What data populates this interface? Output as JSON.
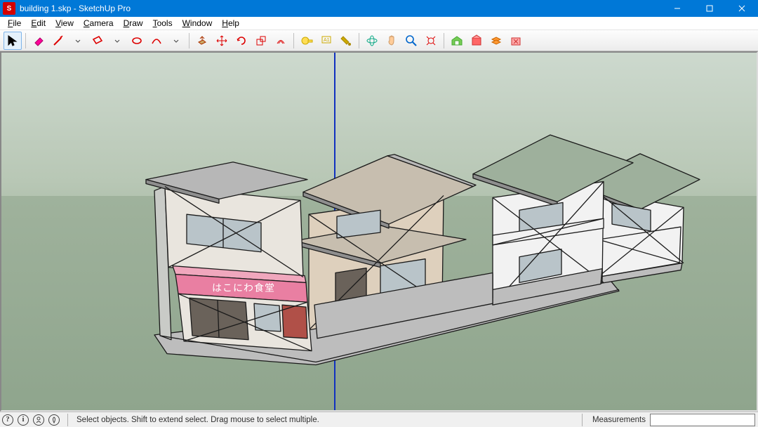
{
  "titlebar": {
    "title": "building 1.skp - SketchUp Pro"
  },
  "menus": {
    "file": {
      "label": "File",
      "hotkey_index": 0
    },
    "edit": {
      "label": "Edit",
      "hotkey_index": 0
    },
    "view": {
      "label": "View",
      "hotkey_index": 0
    },
    "camera": {
      "label": "Camera",
      "hotkey_index": 0
    },
    "draw": {
      "label": "Draw",
      "hotkey_index": 0
    },
    "tools": {
      "label": "Tools",
      "hotkey_index": 0
    },
    "window": {
      "label": "Window",
      "hotkey_index": 0
    },
    "help": {
      "label": "Help",
      "hotkey_index": 0
    }
  },
  "toolbar_icons": [
    "select",
    "eraser",
    "line",
    "freehand",
    "rectangle",
    "circle",
    "arc",
    "pushpull",
    "move",
    "rotate",
    "scale",
    "offset",
    "followme",
    "intersect",
    "tape",
    "text",
    "paint",
    "orbit",
    "pan",
    "zoom",
    "zoom-extents",
    "warehouse",
    "extensions",
    "layers",
    "delete"
  ],
  "scene": {
    "sign_text": "はこにわ食堂"
  },
  "statusbar": {
    "icons": [
      "help",
      "info",
      "user",
      "geo"
    ],
    "hint": "Select objects. Shift to extend select. Drag mouse to select multiple.",
    "measurements_label": "Measurements",
    "measurements_value": ""
  }
}
